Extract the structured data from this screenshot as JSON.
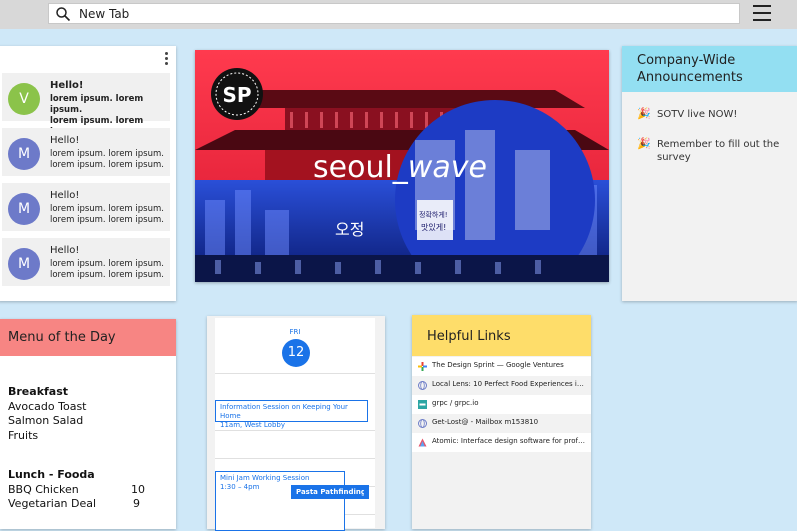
{
  "browser": {
    "url_text": "New Tab"
  },
  "messages": [
    {
      "avatar": "V",
      "title": "Hello!",
      "line1": "lorem ipsum. lorem ipsum.",
      "line2": "lorem ipsum. lorem ipsum.",
      "color": "#8bc34a",
      "unread": true
    },
    {
      "avatar": "M",
      "title": "Hello!",
      "line1": "lorem ipsum. lorem ipsum.",
      "line2": "lorem ipsum. lorem ipsum.",
      "color": "#6d7ac9",
      "unread": false
    },
    {
      "avatar": "M",
      "title": "Hello!",
      "line1": "lorem ipsum. lorem ipsum.",
      "line2": "lorem ipsum. lorem ipsum.",
      "color": "#6d7ac9",
      "unread": false
    },
    {
      "avatar": "M",
      "title": "Hello!",
      "line1": "lorem ipsum. lorem ipsum.",
      "line2": "lorem ipsum. lorem ipsum.",
      "color": "#6d7ac9",
      "unread": false
    }
  ],
  "banner": {
    "logo_text": "SP",
    "title_plain": "seoul_",
    "title_italic": "wave",
    "sign1": "오정",
    "sign2": "정확하게!",
    "sign3": "맛있게!"
  },
  "announcements": {
    "title_line1": "Company-Wide",
    "title_line2": "Announcements",
    "items": [
      {
        "text": "SOTV live NOW!",
        "icon": "party-popper-icon"
      },
      {
        "text": "Remember to fill out the survey",
        "icon": "party-popper-icon"
      }
    ]
  },
  "menu": {
    "title": "Menu of the Day",
    "breakfast_title": "Breakfast",
    "breakfast_items": [
      "Avocado Toast",
      "Salmon Salad",
      "Fruits"
    ],
    "lunch_title": "Lunch - Fooda",
    "lunch_items": [
      {
        "name": "BBQ Chicken",
        "count": "10"
      },
      {
        "name": "Vegetarian Deal",
        "count": "9"
      }
    ]
  },
  "calendar": {
    "day": "FRI",
    "date": "12",
    "events": [
      {
        "title": "Information Session on Keeping Your Home",
        "detail": "11am, West Lobby"
      },
      {
        "title": "Mini Jam Working Session",
        "detail": "1:30 – 4pm"
      },
      {
        "title": "Pasta Pathfinding Mi",
        "detail": ""
      }
    ]
  },
  "links": {
    "title": "Helpful Links",
    "items": [
      {
        "text": "The Design Sprint — Google Ventures",
        "icon": "google-plus-icon"
      },
      {
        "text": "Local Lens: 10 Perfect Food Experiences in Pa...",
        "icon": "globe-icon"
      },
      {
        "text": "grpc / grpc.io",
        "icon": "grpc-icon"
      },
      {
        "text": "Get-Lost@ - Mailbox m153810",
        "icon": "globe-icon"
      },
      {
        "text": "Atomic: Interface design software for profess...",
        "icon": "atomic-icon"
      }
    ]
  }
}
